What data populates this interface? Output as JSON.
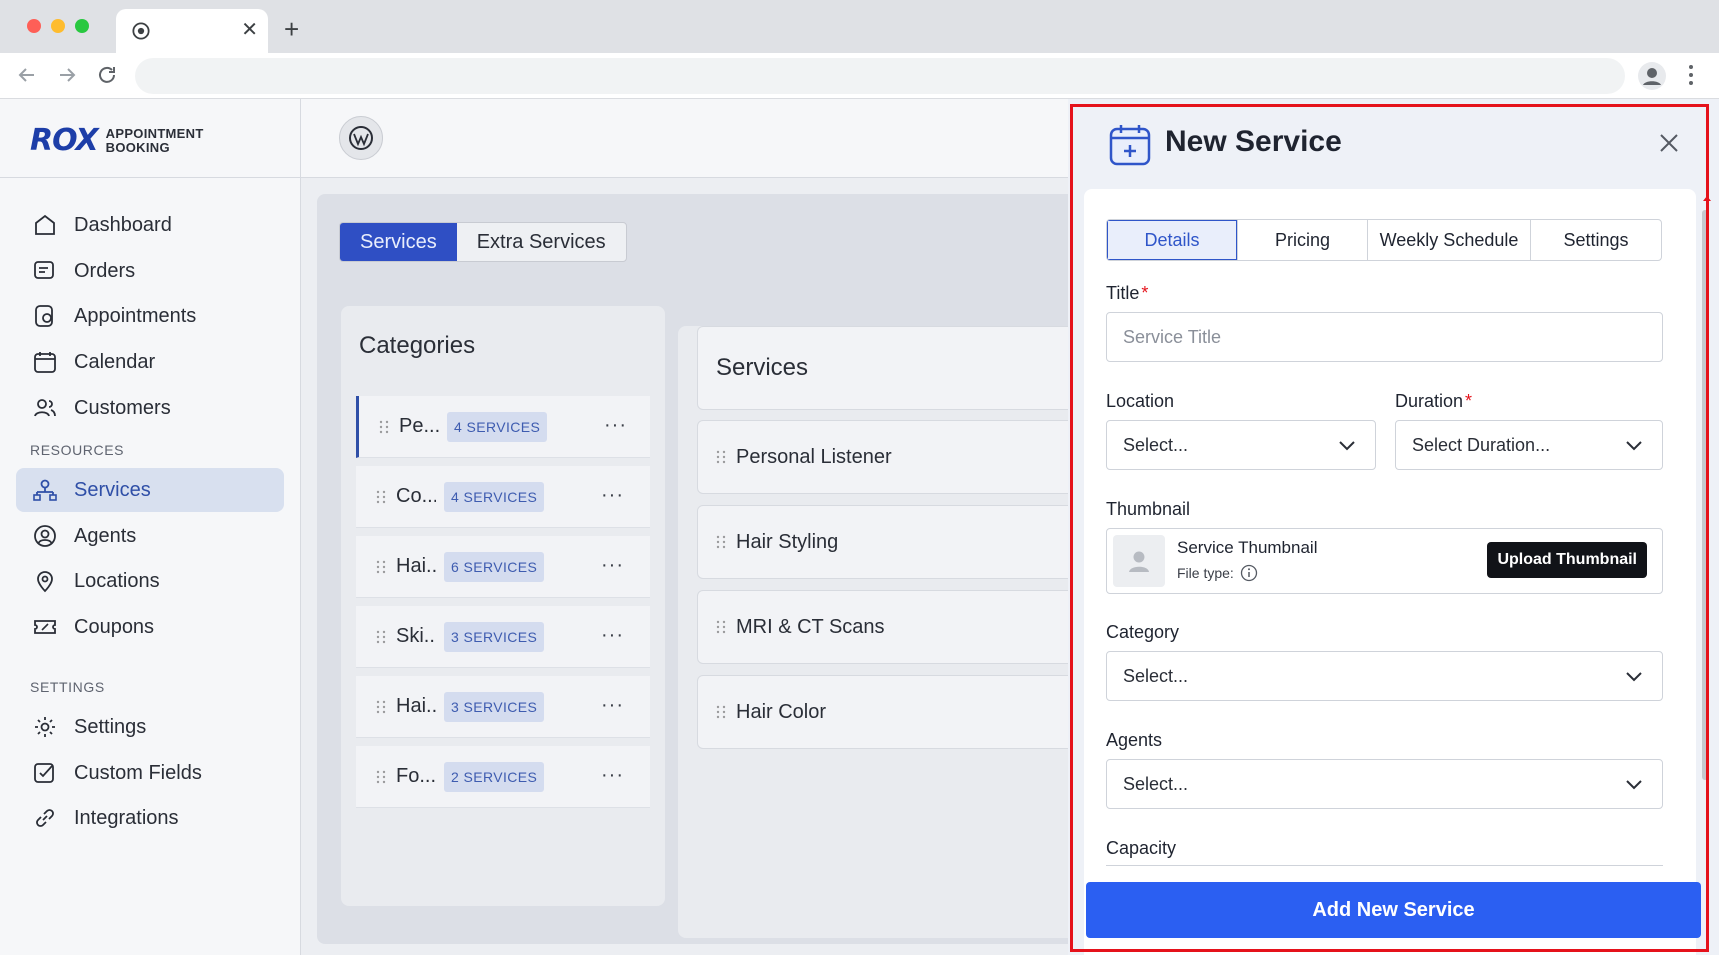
{
  "browser": {
    "tab_close": "✕",
    "new_tab": "+"
  },
  "logo": {
    "mark": "ROX",
    "line1": "APPOINTMENT",
    "line2": "BOOKING"
  },
  "sidebar": {
    "main_items": [
      "Dashboard",
      "Orders",
      "Appointments",
      "Calendar",
      "Customers"
    ],
    "resources_heading": "RESOURCES",
    "resources_items": [
      "Services",
      "Agents",
      "Locations",
      "Coupons"
    ],
    "settings_heading": "SETTINGS",
    "settings_items": [
      "Settings",
      "Custom Fields",
      "Integrations"
    ],
    "active": "Services"
  },
  "content": {
    "tabs": [
      "Services",
      "Extra Services"
    ],
    "categories_title": "Categories",
    "categories": [
      {
        "name": "Pe...",
        "badge": "4 SERVICES"
      },
      {
        "name": "Co...",
        "badge": "4 SERVICES"
      },
      {
        "name": "Hai...",
        "badge": "6 SERVICES"
      },
      {
        "name": "Ski...",
        "badge": "3 SERVICES"
      },
      {
        "name": "Hai...",
        "badge": "3 SERVICES"
      },
      {
        "name": "Fo...",
        "badge": "2 SERVICES"
      }
    ],
    "more": "···",
    "services_title": "Services",
    "services": [
      "Personal Listener",
      "Hair Styling",
      "MRI & CT Scans",
      "Hair Color"
    ]
  },
  "drawer": {
    "title": "New Service",
    "tabs": [
      "Details",
      "Pricing",
      "Weekly Schedule",
      "Settings"
    ],
    "active_tab": "Details",
    "title_label": "Title",
    "title_placeholder": "Service Title",
    "required_mark": "*",
    "location_label": "Location",
    "location_value": "Select...",
    "duration_label": "Duration",
    "duration_value": "Select Duration...",
    "thumbnail_label": "Thumbnail",
    "thumbnail_title": "Service Thumbnail",
    "thumbnail_filetype": "File type:",
    "upload_button": "Upload Thumbnail",
    "category_label": "Category",
    "category_value": "Select...",
    "agents_label": "Agents",
    "agents_value": "Select...",
    "capacity_label": "Capacity",
    "submit_button": "Add New Service"
  },
  "colors": {
    "accent": "#2b5ff2",
    "highlight": "#e5121b",
    "active_nav_bg": "#d8e0ef"
  }
}
